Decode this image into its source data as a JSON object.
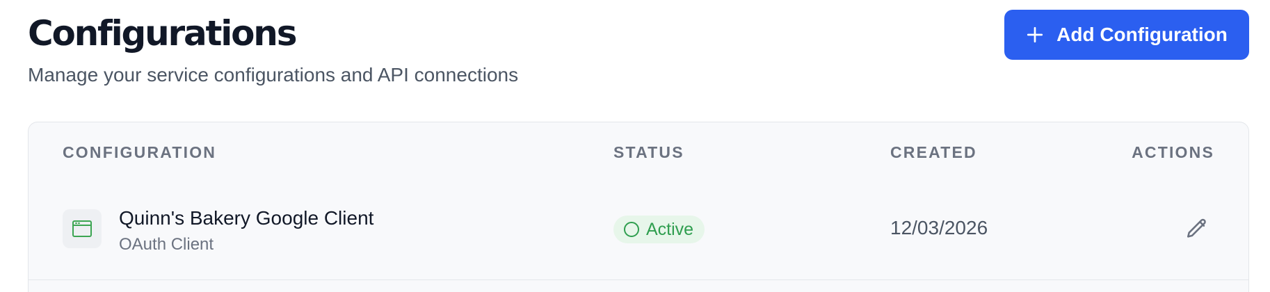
{
  "header": {
    "title": "Configurations",
    "subtitle": "Manage your service configurations and API connections",
    "add_button_label": "Add Configuration",
    "add_button_icon": "plus-icon"
  },
  "table": {
    "columns": {
      "configuration": "CONFIGURATION",
      "status": "STATUS",
      "created": "CREATED",
      "actions": "ACTIONS"
    },
    "rows": [
      {
        "name": "Quinn's Bakery Google Client",
        "type": "OAuth Client",
        "icon": "browser-window-icon",
        "status": "Active",
        "status_color": "#2f9e4f",
        "created": "12/03/2026",
        "action_icon": "pencil-icon"
      }
    ]
  },
  "colors": {
    "accent": "#2b5ff0",
    "success": "#2f9e4f",
    "success_bg": "#e7f6ea",
    "table_bg": "#f8f9fb",
    "config_icon": "#3ca552"
  }
}
